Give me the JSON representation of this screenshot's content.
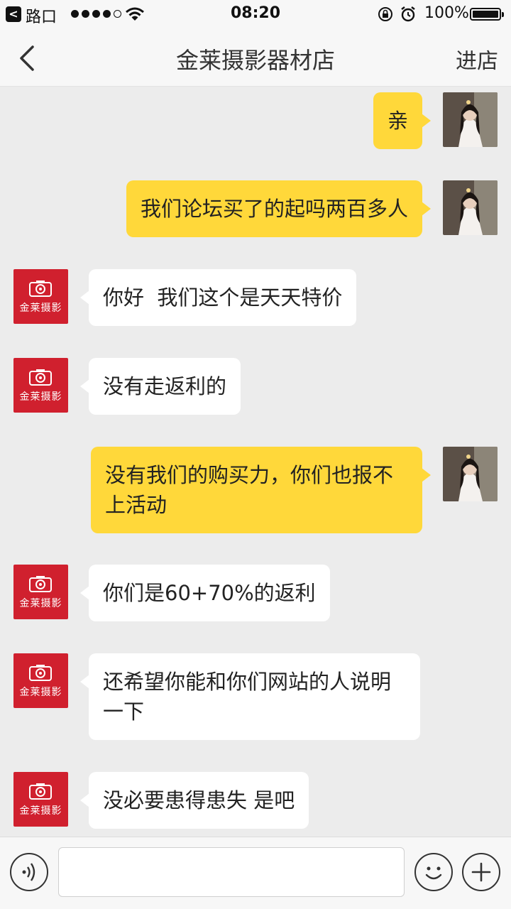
{
  "status_bar": {
    "back_glyph": "<",
    "carrier": "路口",
    "time": "08:20",
    "battery": "100%",
    "signal_bars_filled": 4,
    "signal_bars_total": 5,
    "icons": [
      "back-app-icon",
      "signal-icon",
      "wifi-icon",
      "orientation-lock-icon",
      "alarm-icon",
      "battery-icon"
    ]
  },
  "nav": {
    "back_icon": "chevron-left-icon",
    "title": "金莱摄影器材店",
    "action": "进店"
  },
  "shop_avatar_label": "金莱摄影",
  "messages": [
    {
      "from": "me",
      "text": "亲"
    },
    {
      "from": "me",
      "text": "我们论坛买了的起吗两百多人"
    },
    {
      "from": "shop",
      "text": "你好  我们这个是天天特价"
    },
    {
      "from": "shop",
      "text": "没有走返利的"
    },
    {
      "from": "me",
      "text": "没有我们的购买力，你们也报不上活动"
    },
    {
      "from": "shop",
      "text": "你们是60+70%的返利"
    },
    {
      "from": "shop",
      "text": "还希望你能和你们网站的人说明一下"
    },
    {
      "from": "shop",
      "text": "没必要患得患失 是吧"
    }
  ],
  "input_bar": {
    "value": "",
    "icons": [
      "voice-icon",
      "emoji-icon",
      "plus-icon"
    ]
  },
  "colors": {
    "my_bubble": "#ffd83a",
    "other_bubble": "#ffffff",
    "shop_brand": "#d0202e",
    "background": "#ececec"
  }
}
